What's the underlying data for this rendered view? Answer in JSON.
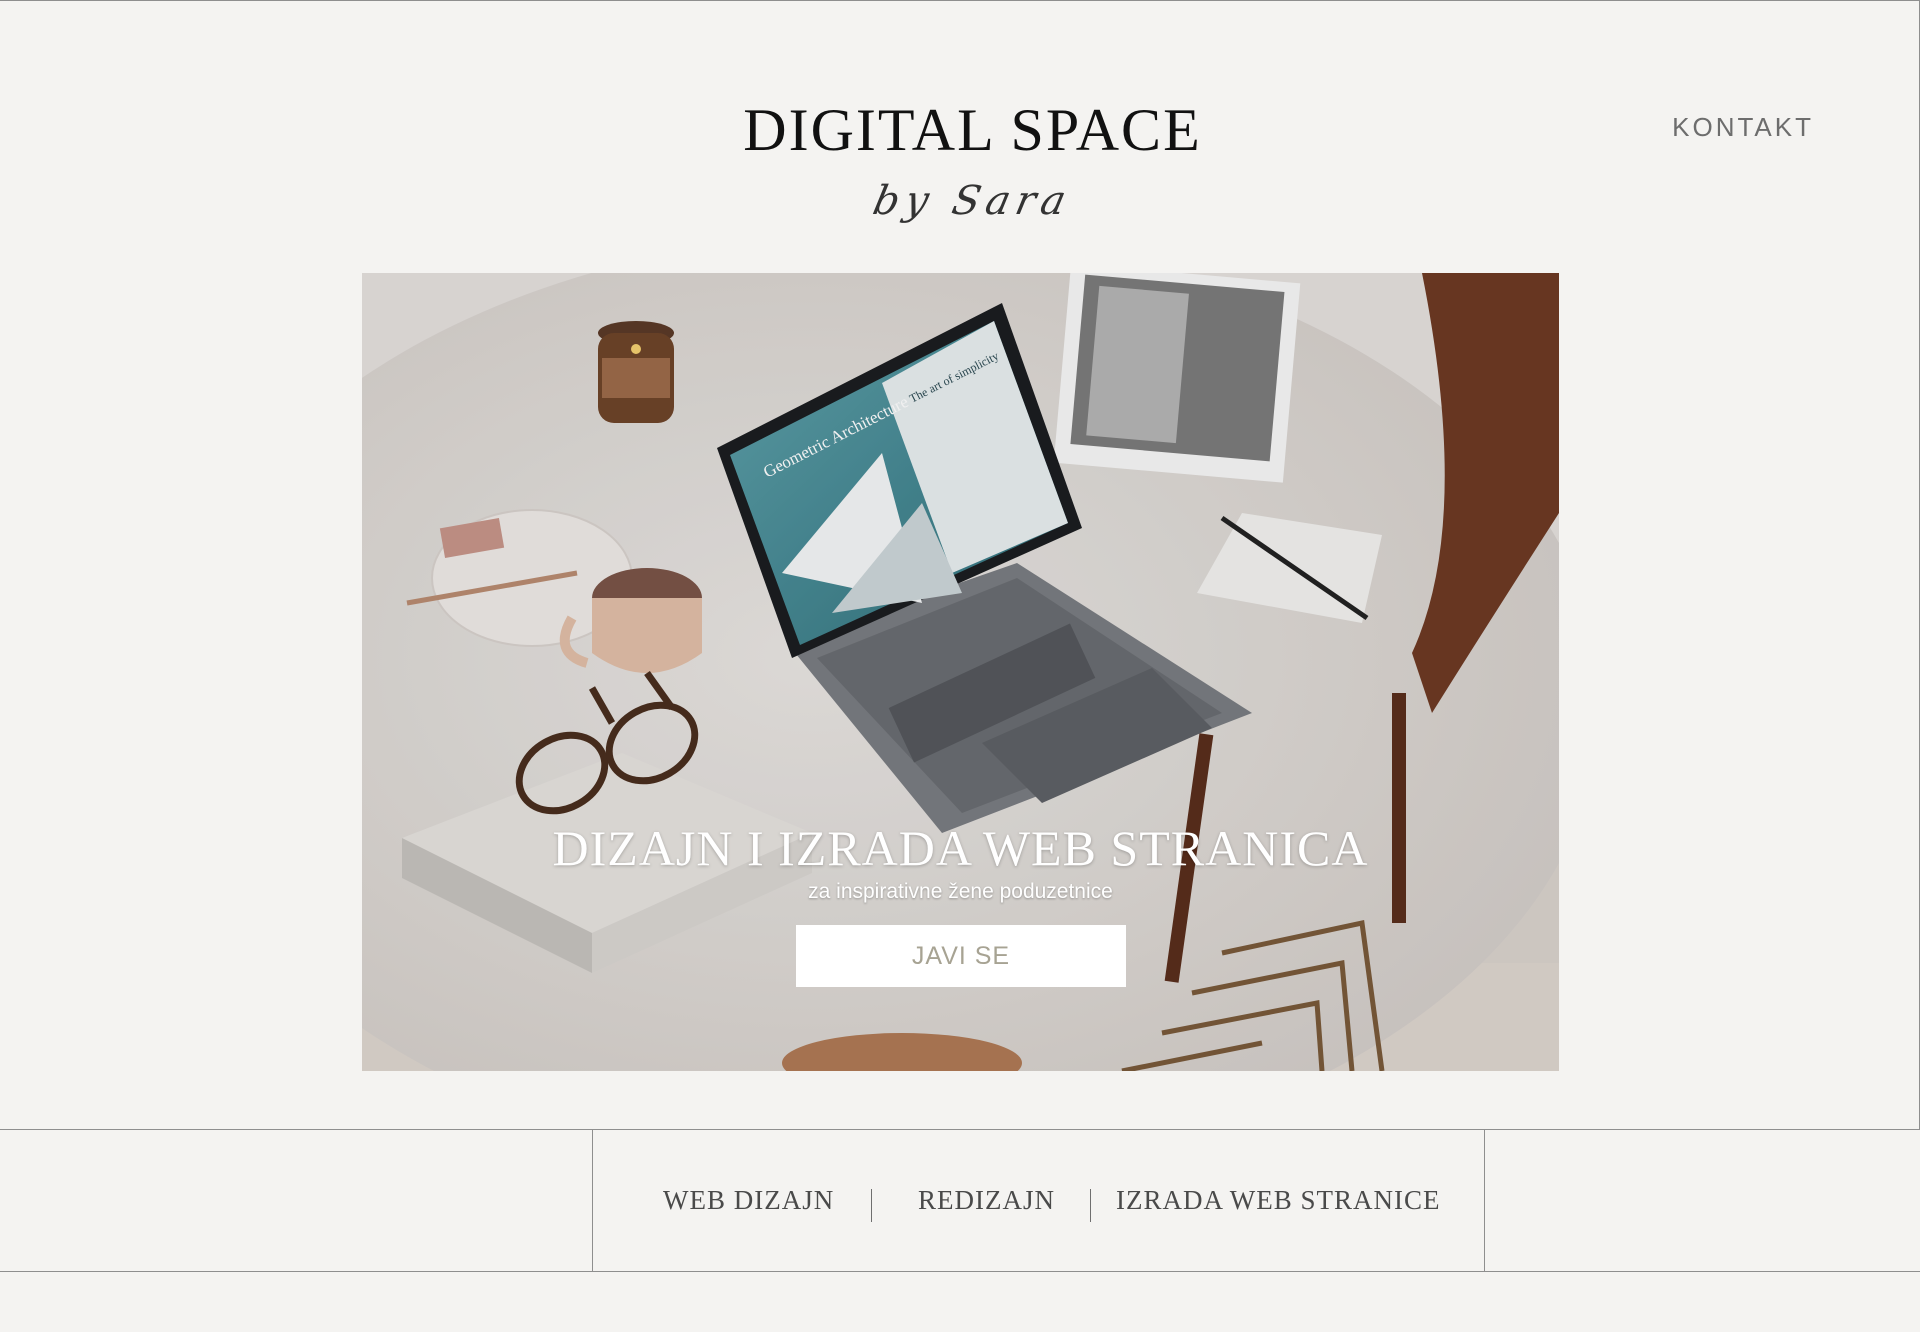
{
  "header": {
    "title": "DIGITAL SPACE",
    "subtitle": "by Sara",
    "contact_label": "KONTAKT"
  },
  "hero": {
    "title": "DIZAJN I IZRADA WEB STRANICA",
    "subtitle": "za inspirativne žene poduzetnice",
    "cta_label": "JAVI SE",
    "screen_text": "Geometric Architecture",
    "screen_text_2": "The art of simplicity"
  },
  "nav": {
    "items": [
      {
        "label": "WEB DIZAJN"
      },
      {
        "label": "REDIZAJN"
      },
      {
        "label": "IZRADA WEB STRANICE"
      }
    ]
  },
  "colors": {
    "background": "#f4f3f1",
    "cta_text": "#a7a393",
    "lines": "#8e8e8e"
  }
}
